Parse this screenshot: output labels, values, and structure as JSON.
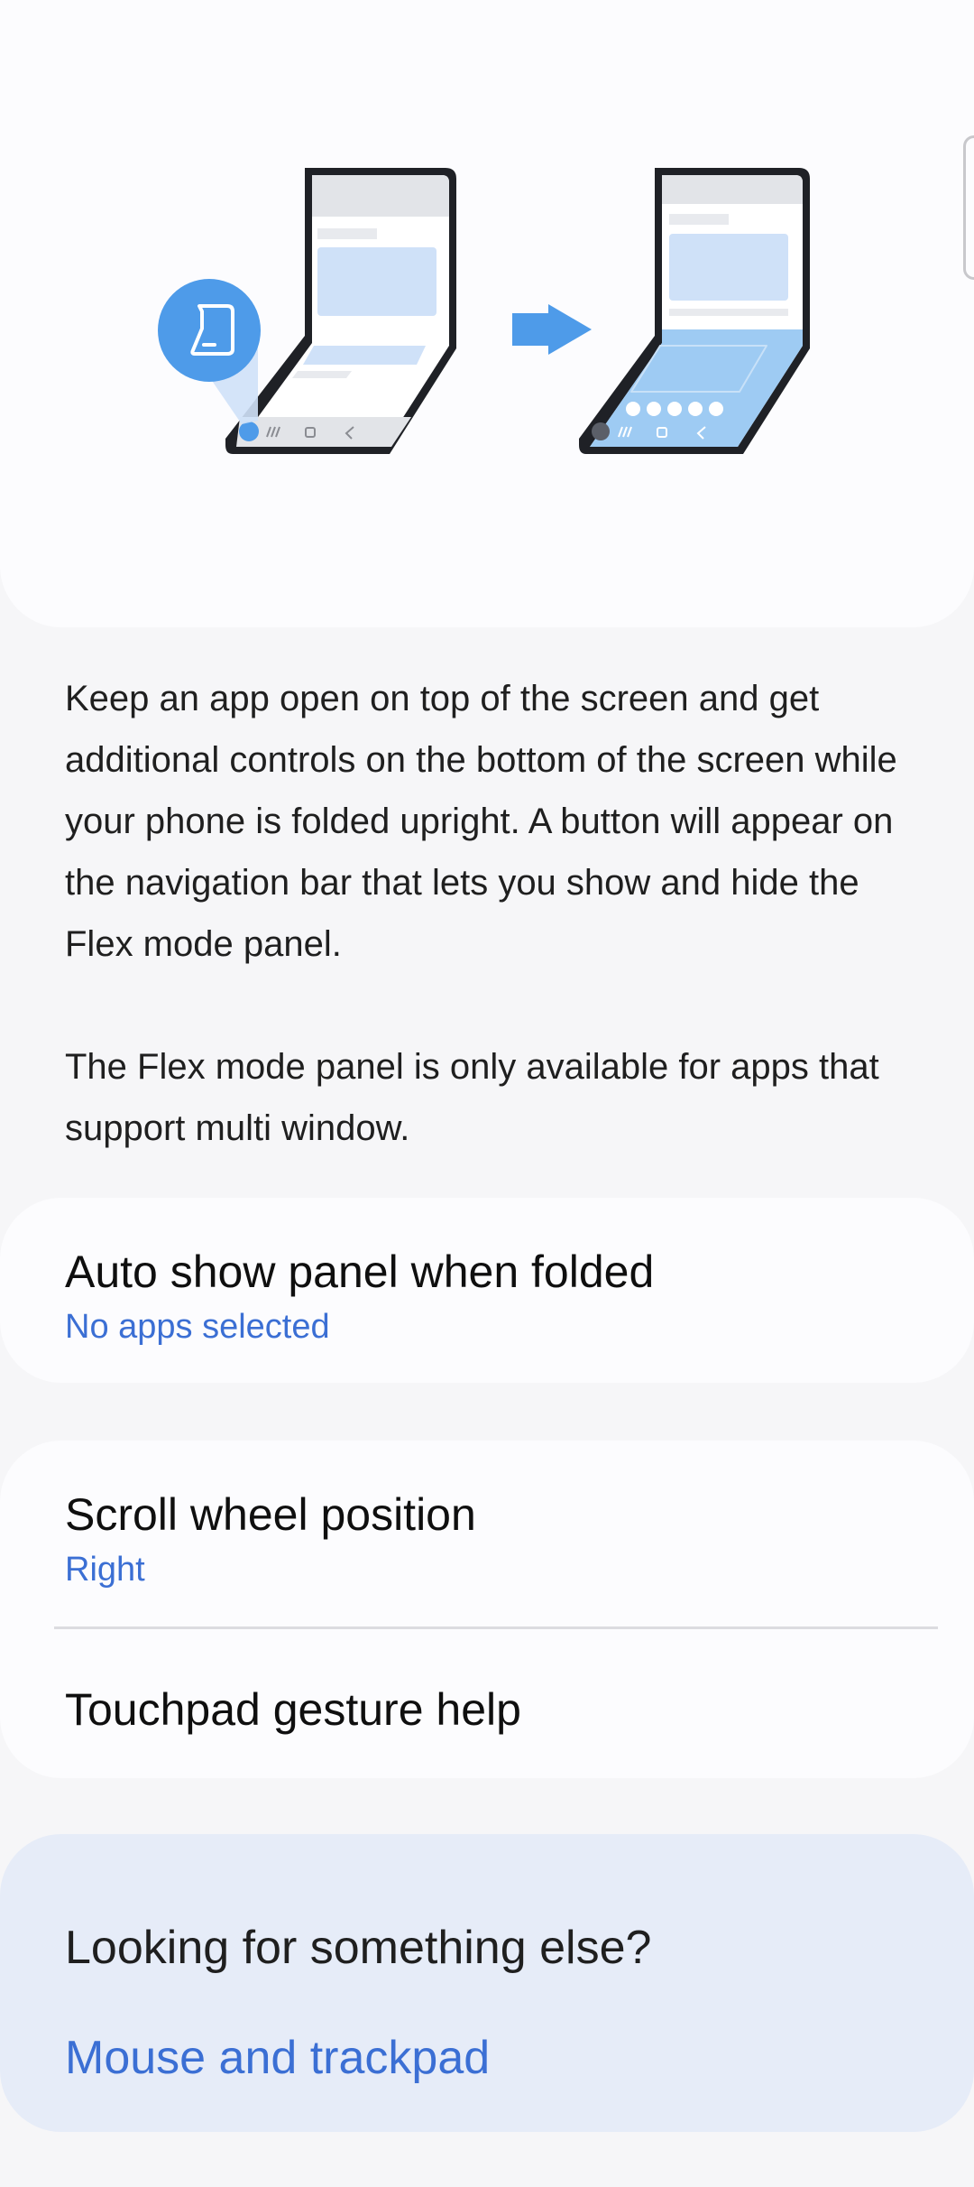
{
  "description": {
    "paragraph1": "Keep an app open on top of the screen and get additional controls on the bottom of the screen while your phone is folded upright. A button will appear on the navigation bar that lets you show and hide the Flex mode panel.",
    "paragraph2": "The Flex mode panel is only available for apps that support multi window."
  },
  "settings": {
    "auto_show": {
      "title": "Auto show panel when folded",
      "value": "No apps selected"
    },
    "scroll_wheel": {
      "title": "Scroll wheel position",
      "value": "Right"
    },
    "touchpad_help": {
      "title": "Touchpad gesture help"
    }
  },
  "suggestions": {
    "title": "Looking for something else?",
    "link": "Mouse and trackpad"
  },
  "colors": {
    "accent": "#3b6fd4",
    "illustration_blue": "#4e9be9",
    "card_background": "#fcfcfe",
    "page_background": "#f6f6f8",
    "suggestion_background": "#e6ecf8"
  },
  "icons": [
    "flex-panel-button-icon",
    "arrow-right-icon",
    "folded-phone-illustration"
  ]
}
